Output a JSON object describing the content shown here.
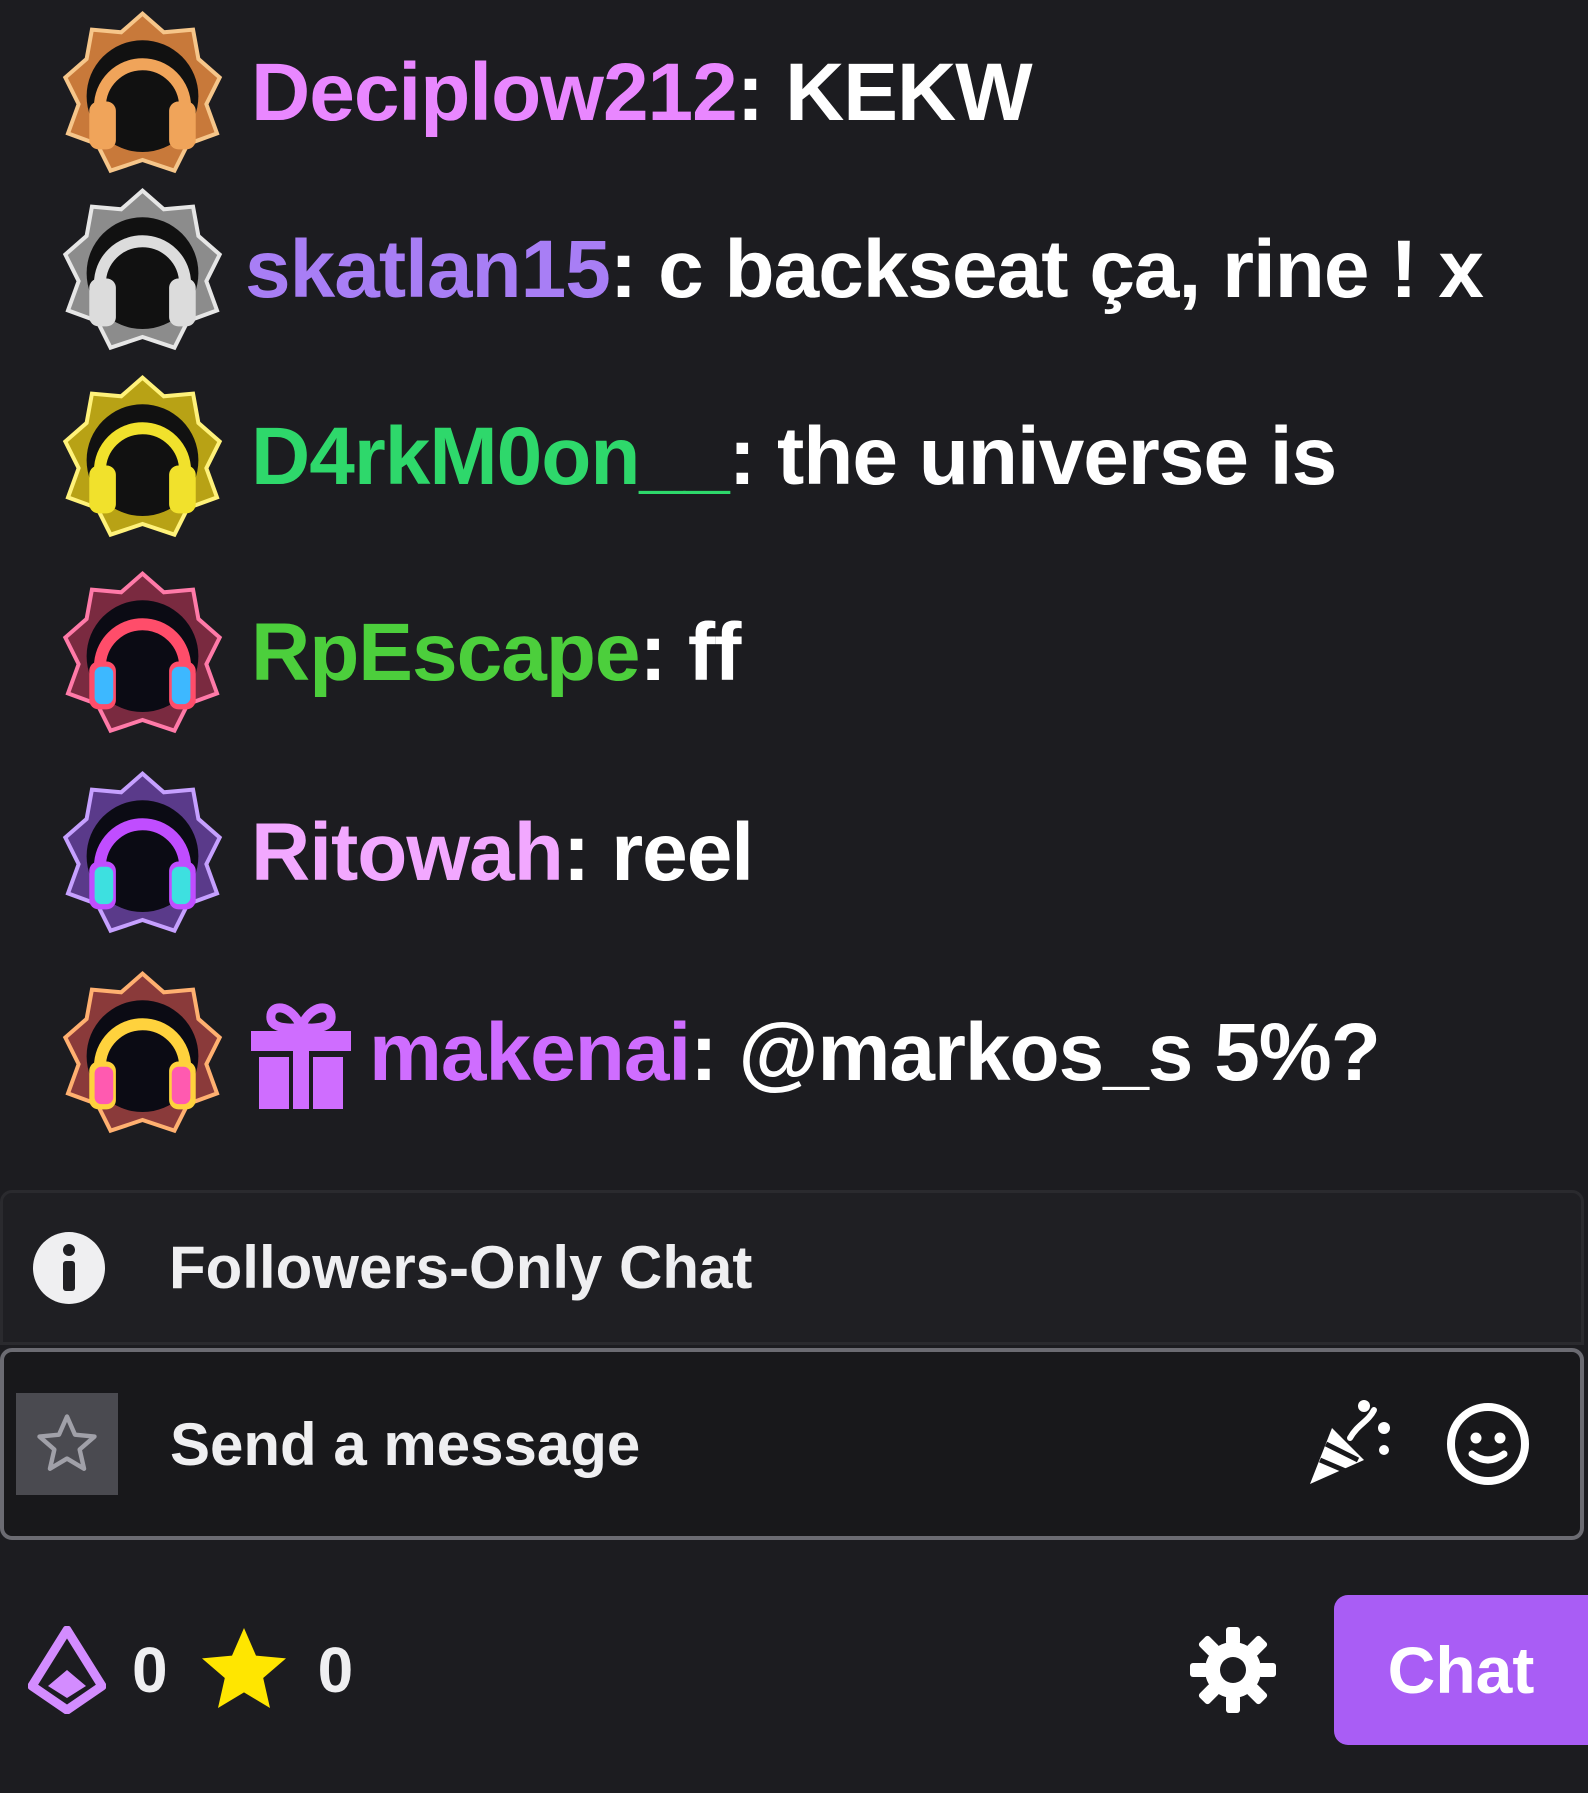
{
  "messages": [
    {
      "username": "Deciplow212",
      "color": "#e987ff",
      "text": "KEKW",
      "badge": "headphones-badge-orange",
      "gift": false
    },
    {
      "username": "skatlan15",
      "color": "#a87ef5",
      "text": "c backseat ça, rine ! x",
      "badge": "headphones-badge-silver",
      "gift": false
    },
    {
      "username": "D4rkM0on__",
      "color": "#2ed86b",
      "text": "the universe is",
      "badge": "headphones-badge-yellow",
      "gift": false
    },
    {
      "username": "RpEscape",
      "color": "#4ccf3c",
      "text": "ff",
      "badge": "headphones-badge-neon-red",
      "gift": false
    },
    {
      "username": "Ritowah",
      "color": "#f2a8ff",
      "text": "reel",
      "badge": "headphones-badge-neon-purple",
      "gift": false
    },
    {
      "username": "makenai",
      "color": "#cf6dff",
      "text": "@markos_s 5%?",
      "badge": "headphones-badge-neon-gold",
      "gift": true
    }
  ],
  "followers_bar": {
    "text": "Followers-Only Chat",
    "icon": "info-icon"
  },
  "input": {
    "placeholder": "Send a message",
    "left_icon": "star-outline-icon",
    "right_icons": [
      "party-popper-icon",
      "emote-smiley-icon"
    ]
  },
  "bottom": {
    "channel_points": "0",
    "stars": "0",
    "chat_button_label": "Chat",
    "icons": [
      "channel-points-icon",
      "yellow-star-icon",
      "gear-icon"
    ]
  },
  "colors": {
    "background": "#1c1c20",
    "accent": "#a95df5",
    "star": "#ffe600"
  }
}
